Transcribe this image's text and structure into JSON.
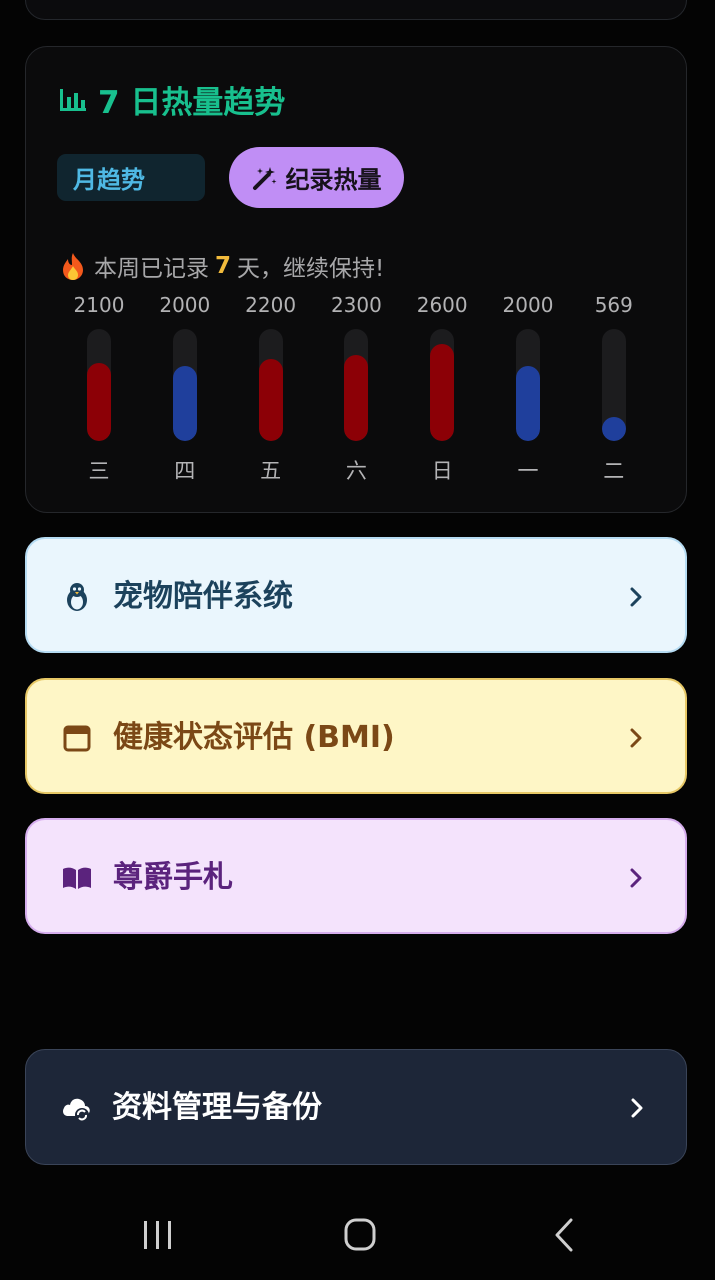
{
  "trend": {
    "title": "7 日热量趋势",
    "month_button": "月趋势",
    "record_button": "纪录热量",
    "streak_prefix": "本周已记录",
    "streak_days": "7",
    "streak_suffix": "天，继续保持!"
  },
  "chart_data": {
    "type": "bar",
    "categories": [
      "三",
      "四",
      "五",
      "六",
      "日",
      "一",
      "二"
    ],
    "values": [
      2100,
      2000,
      2200,
      2300,
      2600,
      2000,
      569
    ],
    "value_labels": [
      "2100",
      "2000",
      "2200",
      "2300",
      "2600",
      "2000",
      "569"
    ],
    "bar_colors": [
      "#8c0006",
      "#1f3f9c",
      "#8c0006",
      "#8c0006",
      "#8c0006",
      "#1f3f9c",
      "#1f3f9c"
    ],
    "ylim": [
      0,
      3000
    ]
  },
  "menu": {
    "pet": {
      "label": "宠物陪伴系统",
      "icon": "penguin-icon"
    },
    "bmi": {
      "label": "健康状态评估 (BMI)",
      "icon": "calendar-icon"
    },
    "book": {
      "label": "尊爵手札",
      "icon": "book-icon"
    },
    "data": {
      "label": "资料管理与备份",
      "icon": "cloud-sync-icon"
    }
  },
  "colors": {
    "accent_green": "#18c08e",
    "over_target": "#8c0006",
    "under_target": "#1f3f9c",
    "streak_number": "#f2bb3c"
  }
}
